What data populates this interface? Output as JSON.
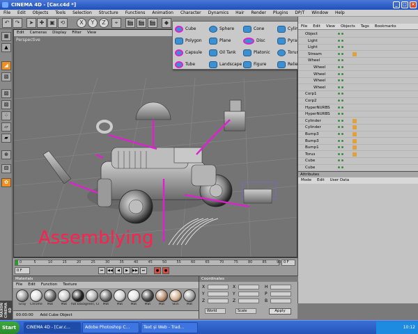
{
  "window": {
    "title": "CINEMA 4D - [Car.c4d *]",
    "buttons": [
      "_",
      "□",
      "×"
    ]
  },
  "menu": [
    "File",
    "Edit",
    "Objects",
    "Tools",
    "Selection",
    "Structure",
    "Functions",
    "Animation",
    "Character",
    "Dynamics",
    "Hair",
    "Render",
    "Plugins",
    "DP/T",
    "Window",
    "Help"
  ],
  "viewport": {
    "menu": [
      "Edit",
      "Cameras",
      "Display",
      "Filter",
      "View"
    ],
    "label": "Perspective",
    "annotation": "Assemblying"
  },
  "palette": {
    "items": [
      [
        "Cube",
        "Sphere",
        "Cone",
        "Cylinder"
      ],
      [
        "Polygon",
        "Plane",
        "Disc",
        "Pyramid"
      ],
      [
        "Capsule",
        "Oil Tank",
        "Platonic",
        "Torus"
      ],
      [
        "Tube",
        "Landscape",
        "Figure",
        "Relief"
      ]
    ]
  },
  "objects_panel": {
    "menu": [
      "File",
      "Edit",
      "View",
      "Objects",
      "Tags",
      "Bookmarks"
    ],
    "rows": [
      "Object",
      "Light",
      "Light",
      "Stream",
      "Wheel",
      "Wheel",
      "Wheel",
      "Wheel",
      "Wheel",
      "Corp1",
      "Corp2",
      "HyperNURBS",
      "HyperNURBS",
      "Cylinder",
      "Cylinder",
      "Bump3",
      "Bump3",
      "Bump1",
      "Torus",
      "Cube",
      "Cube"
    ]
  },
  "attributes": {
    "header": "Attributes",
    "menu": [
      "Mode",
      "Edit",
      "User Data"
    ]
  },
  "timeline": {
    "ticks": [
      "0",
      "5",
      "10",
      "15",
      "20",
      "25",
      "30",
      "35",
      "40",
      "45",
      "50",
      "55",
      "60",
      "65",
      "70",
      "75",
      "80",
      "85",
      "90"
    ],
    "frame_field": "0 F",
    "start": "0 F"
  },
  "materials": {
    "header": "Materials",
    "menu": [
      "File",
      "Edit",
      "Function",
      "Texture"
    ],
    "items": [
      "Gray",
      "Chrome",
      "Mat",
      "Mat",
      "flat black",
      "green, Cl",
      "Mat",
      "Mat",
      "Mat",
      "Mat",
      "Mat",
      "Skin",
      "Mat"
    ],
    "colors": [
      "#9a9a9a",
      "#dcdcdc",
      "#6a6a6a",
      "#c8c8c8",
      "#222222",
      "#b0b0b0",
      "#707070",
      "#d0d0d0",
      "#e0e0e0",
      "#4a4a4a",
      "#b89070",
      "#d0b090",
      "#a0a0a0"
    ]
  },
  "coordinates": {
    "header": "Coordinates",
    "rows": [
      "X",
      "Y",
      "Z"
    ],
    "cols2": [
      "P",
      "B",
      "H"
    ],
    "world": "World",
    "scale": "Scale",
    "apply": "Apply"
  },
  "status": {
    "time": "00:00:00",
    "message": "Add Cube Object"
  },
  "maxon": "MAXON CINEMA 4D",
  "taskbar": {
    "start": "Start",
    "tasks": [
      "CINEMA 4D - [Car.c...",
      "Adobe Photoshop C...",
      "Text și Web - Trad..."
    ],
    "clock": "10:12"
  }
}
